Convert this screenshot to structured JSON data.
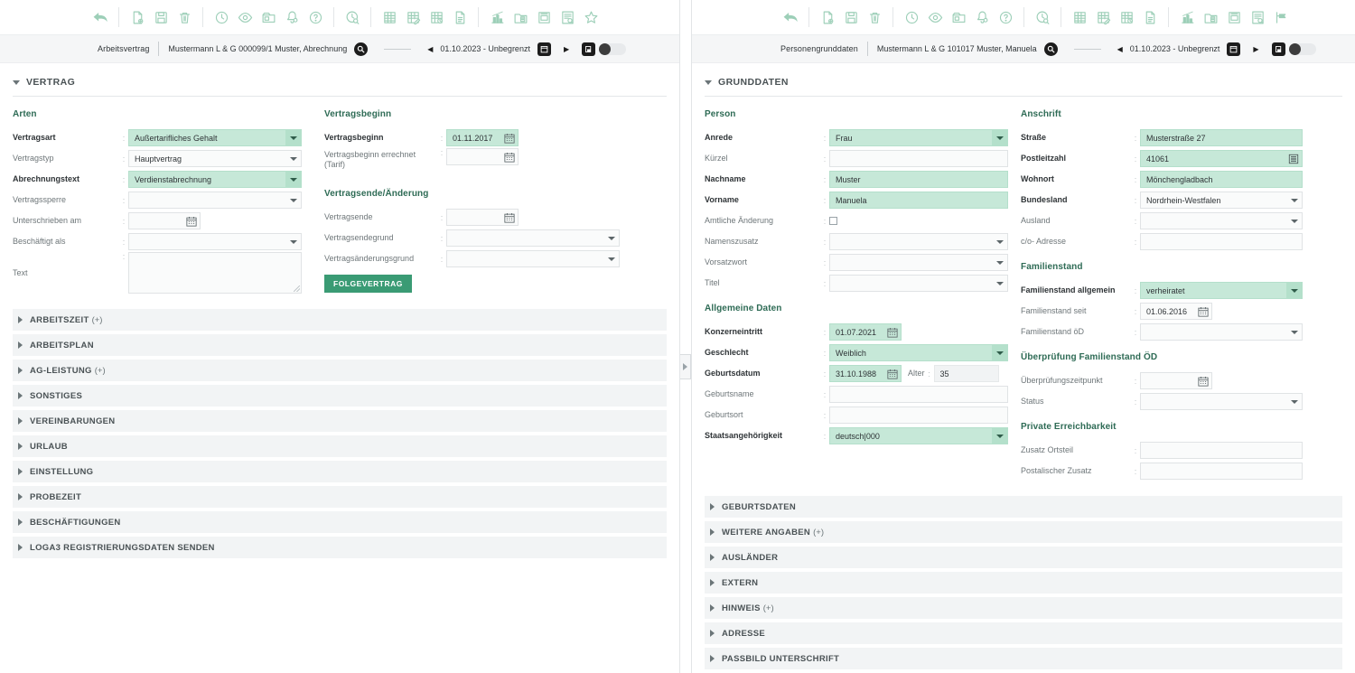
{
  "left_panel": {
    "toolbar": {
      "groups": [
        {
          "icons": [
            {
              "name": "undo-icon",
              "glyph": "undo"
            }
          ]
        },
        {
          "icons": [
            {
              "name": "new-document-icon",
              "glyph": "doc-plus"
            },
            {
              "name": "save-icon",
              "glyph": "floppy"
            },
            {
              "name": "delete-icon",
              "glyph": "trash"
            }
          ]
        },
        {
          "icons": [
            {
              "name": "history-clock-icon",
              "glyph": "clock"
            },
            {
              "name": "preview-eye-icon",
              "glyph": "eye"
            },
            {
              "name": "archive-box-icon",
              "glyph": "archive"
            },
            {
              "name": "notification-bell-icon",
              "glyph": "bell"
            },
            {
              "name": "help-icon",
              "glyph": "question"
            }
          ]
        },
        {
          "icons": [
            {
              "name": "clock-search-icon",
              "glyph": "clock-search"
            }
          ]
        },
        {
          "icons": [
            {
              "name": "payroll-grid-icon",
              "glyph": "grid"
            },
            {
              "name": "payroll-grid-edit-icon",
              "glyph": "grid-edit"
            },
            {
              "name": "payroll-grid-clock-icon",
              "glyph": "grid-clock"
            },
            {
              "name": "report-page-icon",
              "glyph": "page"
            }
          ]
        },
        {
          "icons": [
            {
              "name": "statistics-chart-icon",
              "glyph": "chart"
            },
            {
              "name": "document-folder-icon",
              "glyph": "folder-doc"
            },
            {
              "name": "printer-icon",
              "glyph": "printer"
            },
            {
              "name": "list-search-icon",
              "glyph": "list-search"
            },
            {
              "name": "favorite-star-icon",
              "glyph": "star"
            }
          ]
        }
      ]
    },
    "breadcrumb": {
      "context_label": "Arbeitsvertrag",
      "record_label": "Mustermann L & G 000099/1 Muster, Abrechnung",
      "date_range": "01.10.2023 - Unbegrenzt"
    },
    "section": {
      "title": "VERTRAG"
    },
    "groups": {
      "arten": {
        "title": "Arten",
        "fields": [
          {
            "label": "Vertragsart",
            "value": "Außertarifliches Gehalt",
            "type": "select",
            "state": "filled",
            "label_bold": true
          },
          {
            "label": "Vertragstyp",
            "value": "Hauptvertrag",
            "type": "select",
            "state": "plain",
            "label_bold": false
          },
          {
            "label": "Abrechnungstext",
            "value": "Verdienstabrechnung",
            "type": "select",
            "state": "filled",
            "label_bold": true
          },
          {
            "label": "Vertragssperre",
            "value": "",
            "type": "select",
            "state": "plain",
            "label_bold": false
          },
          {
            "label": "Unterschrieben am",
            "value": "",
            "type": "date",
            "state": "plain",
            "label_bold": false
          },
          {
            "label": "Beschäftigt als",
            "value": "",
            "type": "select",
            "state": "plain",
            "label_bold": false
          },
          {
            "label": "Text",
            "value": "",
            "type": "textarea",
            "state": "plain",
            "label_bold": false
          }
        ]
      },
      "vertragsbeginn": {
        "title": "Vertragsbeginn",
        "fields": [
          {
            "label": "Vertragsbeginn",
            "value": "01.11.2017",
            "type": "date",
            "state": "filled",
            "label_bold": true
          },
          {
            "label": "Vertragsbeginn errechnet (Tarif)",
            "value": "",
            "type": "date",
            "state": "plain",
            "label_bold": false
          }
        ]
      },
      "vertragsende": {
        "title": "Vertragsende/Änderung",
        "fields": [
          {
            "label": "Vertragsende",
            "value": "",
            "type": "date",
            "state": "plain",
            "label_bold": false
          },
          {
            "label": "Vertragsendegrund",
            "value": "",
            "type": "select",
            "state": "plain",
            "label_bold": false
          },
          {
            "label": "Vertragsänderungsgrund",
            "value": "",
            "type": "select",
            "state": "plain",
            "label_bold": false
          }
        ],
        "button_label": "FOLGEVERTRAG"
      }
    },
    "accordions": [
      {
        "label": "ARBEITSZEIT",
        "suffix": "(+)"
      },
      {
        "label": "ARBEITSPLAN",
        "suffix": ""
      },
      {
        "label": "AG-LEISTUNG",
        "suffix": "(+)"
      },
      {
        "label": "SONSTIGES",
        "suffix": ""
      },
      {
        "label": "VEREINBARUNGEN",
        "suffix": ""
      },
      {
        "label": "URLAUB",
        "suffix": ""
      },
      {
        "label": "EINSTELLUNG",
        "suffix": ""
      },
      {
        "label": "PROBEZEIT",
        "suffix": ""
      },
      {
        "label": "BESCHÄFTIGUNGEN",
        "suffix": ""
      },
      {
        "label": "LOGA3 REGISTRIERUNGSDATEN SENDEN",
        "suffix": ""
      }
    ]
  },
  "right_panel": {
    "toolbar": {
      "groups": [
        {
          "icons": [
            {
              "name": "undo-icon",
              "glyph": "undo"
            }
          ]
        },
        {
          "icons": [
            {
              "name": "new-document-icon",
              "glyph": "doc-plus"
            },
            {
              "name": "save-icon",
              "glyph": "floppy"
            },
            {
              "name": "delete-icon",
              "glyph": "trash"
            }
          ]
        },
        {
          "icons": [
            {
              "name": "history-clock-icon",
              "glyph": "clock"
            },
            {
              "name": "preview-eye-icon",
              "glyph": "eye"
            },
            {
              "name": "archive-box-icon",
              "glyph": "archive"
            },
            {
              "name": "notification-bell-icon",
              "glyph": "bell"
            },
            {
              "name": "help-icon",
              "glyph": "question"
            }
          ]
        },
        {
          "icons": [
            {
              "name": "clock-search-icon",
              "glyph": "clock-search"
            }
          ]
        },
        {
          "icons": [
            {
              "name": "payroll-grid-icon",
              "glyph": "grid"
            },
            {
              "name": "payroll-grid-edit-icon",
              "glyph": "grid-edit"
            },
            {
              "name": "payroll-grid-clock-icon",
              "glyph": "grid-clock"
            },
            {
              "name": "report-page-icon",
              "glyph": "page"
            }
          ]
        },
        {
          "icons": [
            {
              "name": "statistics-chart-icon",
              "glyph": "chart"
            },
            {
              "name": "document-folder-icon",
              "glyph": "folder-doc"
            },
            {
              "name": "printer-icon",
              "glyph": "printer"
            },
            {
              "name": "list-search-icon",
              "glyph": "list-search"
            },
            {
              "name": "collapse-panel-icon",
              "glyph": "flag"
            }
          ]
        }
      ]
    },
    "breadcrumb": {
      "context_label": "Personengrunddaten",
      "record_label": "Mustermann L & G 101017 Muster, Manuela",
      "date_range": "01.10.2023 - Unbegrenzt"
    },
    "section": {
      "title": "GRUNDDATEN"
    },
    "groups": {
      "person": {
        "title": "Person",
        "fields": [
          {
            "label": "Anrede",
            "value": "Frau",
            "type": "select",
            "state": "filled",
            "label_bold": true
          },
          {
            "label": "Kürzel",
            "value": "",
            "type": "text",
            "state": "plain",
            "label_bold": false
          },
          {
            "label": "Nachname",
            "value": "Muster",
            "type": "text",
            "state": "filled",
            "label_bold": true
          },
          {
            "label": "Vorname",
            "value": "Manuela",
            "type": "text",
            "state": "filled",
            "label_bold": true
          },
          {
            "label": "Amtliche Änderung",
            "value": "",
            "type": "checkbox",
            "state": "plain",
            "label_bold": false
          },
          {
            "label": "Namenszusatz",
            "value": "",
            "type": "select",
            "state": "plain",
            "label_bold": false
          },
          {
            "label": "Vorsatzwort",
            "value": "",
            "type": "select",
            "state": "plain",
            "label_bold": false
          },
          {
            "label": "Titel",
            "value": "",
            "type": "select",
            "state": "plain",
            "label_bold": false
          }
        ]
      },
      "allgemeine_daten": {
        "title": "Allgemeine Daten",
        "fields": [
          {
            "label": "Konzerneintritt",
            "value": "01.07.2021",
            "type": "date",
            "state": "filled",
            "label_bold": true
          },
          {
            "label": "Geschlecht",
            "value": "Weiblich",
            "type": "select",
            "state": "filled",
            "label_bold": true
          },
          {
            "label": "Geburtsdatum",
            "value": "31.10.1988",
            "type": "date-age",
            "state": "filled",
            "label_bold": true,
            "sub_label": "Alter",
            "sub_value": "35"
          },
          {
            "label": "Geburtsname",
            "value": "",
            "type": "text",
            "state": "plain",
            "label_bold": false
          },
          {
            "label": "Geburtsort",
            "value": "",
            "type": "text",
            "state": "plain",
            "label_bold": false
          },
          {
            "label": "Staatsangehörigkeit",
            "value": "deutsch|000",
            "type": "select",
            "state": "filled",
            "label_bold": true
          }
        ]
      },
      "anschrift": {
        "title": "Anschrift",
        "fields": [
          {
            "label": "Straße",
            "value": "Musterstraße 27",
            "type": "text",
            "state": "filled",
            "label_bold": true
          },
          {
            "label": "Postleitzahl",
            "value": "41061",
            "type": "text-list",
            "state": "filled",
            "label_bold": true
          },
          {
            "label": "Wohnort",
            "value": "Mönchengladbach",
            "type": "text",
            "state": "filled",
            "label_bold": true
          },
          {
            "label": "Bundesland",
            "value": "Nordrhein-Westfalen",
            "type": "select",
            "state": "plain",
            "label_bold": true
          },
          {
            "label": "Ausland",
            "value": "",
            "type": "select",
            "state": "plain",
            "label_bold": false
          },
          {
            "label": "c/o- Adresse",
            "value": "",
            "type": "text",
            "state": "plain",
            "label_bold": false
          }
        ]
      },
      "familienstand": {
        "title": "Familienstand",
        "fields": [
          {
            "label": "Familienstand allgemein",
            "value": "verheiratet",
            "type": "select",
            "state": "filled",
            "label_bold": true
          },
          {
            "label": "Familienstand seit",
            "value": "01.06.2016",
            "type": "date",
            "state": "plain",
            "label_bold": false
          },
          {
            "label": "Familienstand öD",
            "value": "",
            "type": "select",
            "state": "plain",
            "label_bold": false
          }
        ]
      },
      "ueberpruefung": {
        "title": "Überprüfung Familienstand ÖD",
        "fields": [
          {
            "label": "Überprüfungszeitpunkt",
            "value": "",
            "type": "date",
            "state": "plain",
            "label_bold": false
          },
          {
            "label": "Status",
            "value": "",
            "type": "select",
            "state": "plain",
            "label_bold": false
          }
        ]
      },
      "erreichbarkeit": {
        "title": "Private Erreichbarkeit",
        "fields": [
          {
            "label": "Zusatz Ortsteil",
            "value": "",
            "type": "text",
            "state": "plain",
            "label_bold": false
          },
          {
            "label": "Postalischer Zusatz",
            "value": "",
            "type": "text",
            "state": "plain",
            "label_bold": false
          }
        ]
      }
    },
    "accordions": [
      {
        "label": "GEBURTSDATEN",
        "suffix": ""
      },
      {
        "label": "WEITERE ANGABEN",
        "suffix": "(+)"
      },
      {
        "label": "AUSLÄNDER",
        "suffix": ""
      },
      {
        "label": "EXTERN",
        "suffix": ""
      },
      {
        "label": "HINWEIS",
        "suffix": "(+)"
      },
      {
        "label": "ADRESSE",
        "suffix": ""
      },
      {
        "label": "PASSBILD UNTERSCHRIFT",
        "suffix": ""
      }
    ]
  },
  "colors": {
    "accent_green": "#3a9b74",
    "icon_green": "#9dcfb8",
    "field_filled": "#c6e8d8",
    "group_title": "#2e6b55",
    "accordion_bg": "#f2f4f5",
    "label_gray": "#6e7679"
  }
}
